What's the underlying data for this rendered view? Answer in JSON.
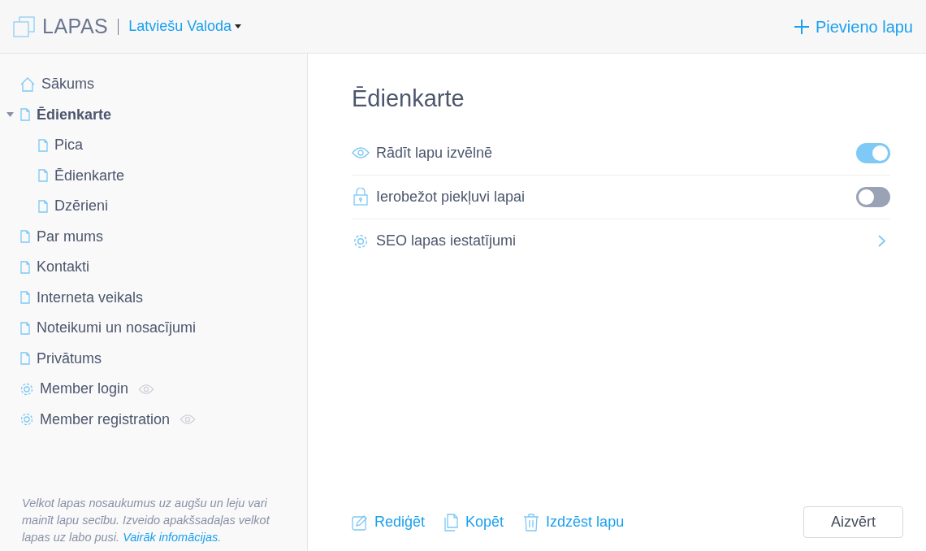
{
  "header": {
    "title": "LAPAS",
    "language": "Latviešu Valoda",
    "add_button": "Pievieno lapu"
  },
  "sidebar": {
    "items": [
      {
        "label": "Sākums",
        "kind": "home",
        "selected": false,
        "hidden": false
      },
      {
        "label": "Ēdienkarte",
        "kind": "page",
        "selected": true,
        "hidden": false,
        "expanded": true,
        "children": [
          {
            "label": "Pica",
            "kind": "page",
            "selected": false,
            "hidden": false
          },
          {
            "label": "Ēdienkarte",
            "kind": "page",
            "selected": false,
            "hidden": false
          },
          {
            "label": "Dzērieni",
            "kind": "page",
            "selected": false,
            "hidden": false
          }
        ]
      },
      {
        "label": "Par mums",
        "kind": "page",
        "selected": false,
        "hidden": false
      },
      {
        "label": "Kontakti",
        "kind": "page",
        "selected": false,
        "hidden": false
      },
      {
        "label": "Interneta veikals",
        "kind": "page",
        "selected": false,
        "hidden": false
      },
      {
        "label": "Noteikumi un nosacījumi",
        "kind": "page",
        "selected": false,
        "hidden": false
      },
      {
        "label": "Privātums",
        "kind": "page",
        "selected": false,
        "hidden": false
      },
      {
        "label": "Member login",
        "kind": "settings",
        "selected": false,
        "hidden": true
      },
      {
        "label": "Member registration",
        "kind": "settings",
        "selected": false,
        "hidden": true
      }
    ],
    "hint": "Velkot lapas nosaukumus uz augšu un leju vari mainīt lapu secību. Izveido apakšsadaļas velkot lapas uz labo pusi.",
    "hint_link": "Vairāk infomācijas",
    "hint_end": "."
  },
  "page": {
    "title": "Ēdienkarte",
    "settings": [
      {
        "label": "Rādīt lapu izvēlnē",
        "kind": "toggle",
        "on": true
      },
      {
        "label": "Ierobežot piekļuvi lapai",
        "kind": "toggle",
        "on": false
      },
      {
        "label": "SEO lapas iestatījumi",
        "kind": "link"
      }
    ],
    "actions": [
      {
        "label": "Rediģēt"
      },
      {
        "label": "Kopēt"
      },
      {
        "label": "Izdzēst lapu"
      }
    ],
    "close_button": "Aizvērt"
  }
}
